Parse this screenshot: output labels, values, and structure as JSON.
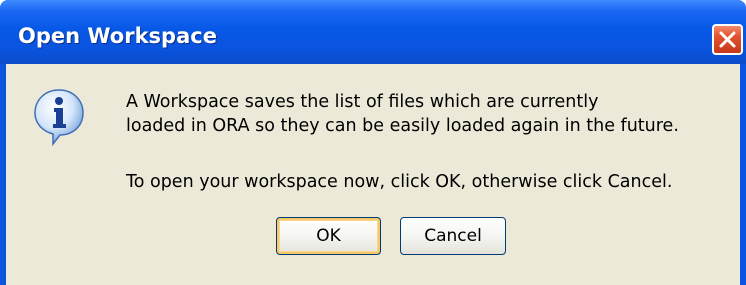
{
  "window": {
    "title": "Open Workspace",
    "close_icon": "close-icon"
  },
  "dialog": {
    "icon": "info-icon",
    "message_line_1": "A Workspace saves the list of files which are currently",
    "message_line_2": "loaded in ORA so they can be easily loaded again in the future.",
    "message_line_3": "To open your workspace now, click OK, otherwise click Cancel."
  },
  "buttons": {
    "ok_label": "OK",
    "cancel_label": "Cancel"
  },
  "colors": {
    "titlebar": "#0a54e0",
    "client_bg": "#ece9d8",
    "close_button": "#e2522d",
    "button_border": "#003c74"
  }
}
